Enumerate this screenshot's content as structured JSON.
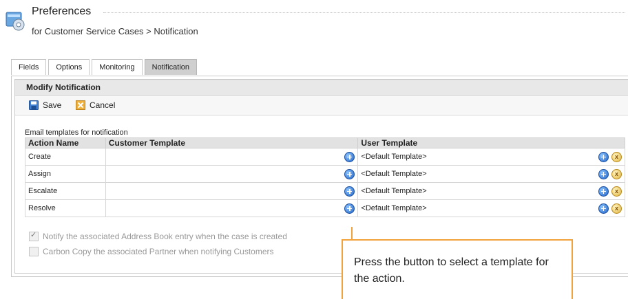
{
  "header": {
    "title": "Preferences",
    "subtitle": "for Customer Service Cases > Notification",
    "icon": "preferences-icon"
  },
  "tabs": [
    {
      "label": "Fields",
      "active": false
    },
    {
      "label": "Options",
      "active": false
    },
    {
      "label": "Monitoring",
      "active": false
    },
    {
      "label": "Notification",
      "active": true
    }
  ],
  "panel": {
    "title": "Modify Notification",
    "save_label": "Save",
    "cancel_label": "Cancel",
    "section_label": "Email templates for notification"
  },
  "table": {
    "headers": [
      "Action Name",
      "Customer Template",
      "User Template"
    ],
    "rows": [
      {
        "action": "Create",
        "customer_template": "",
        "user_template": "<Default Template>"
      },
      {
        "action": "Assign",
        "customer_template": "",
        "user_template": "<Default Template>"
      },
      {
        "action": "Escalate",
        "customer_template": "",
        "user_template": "<Default Template>"
      },
      {
        "action": "Resolve",
        "customer_template": "",
        "user_template": "<Default Template>"
      }
    ]
  },
  "options": {
    "notify_address_book": {
      "label": "Notify the associated Address Book entry when the case is created",
      "checked": true
    },
    "carbon_copy_partner": {
      "label": "Carbon Copy the associated Partner when notifying Customers",
      "checked": false
    }
  },
  "callout": {
    "text": "Press the button to select a template for the action."
  },
  "colors": {
    "callout_border": "#f2a23a",
    "active_tab": "#cfcfcf",
    "add_button": "#1f62c8",
    "remove_button": "#e0b23b"
  }
}
